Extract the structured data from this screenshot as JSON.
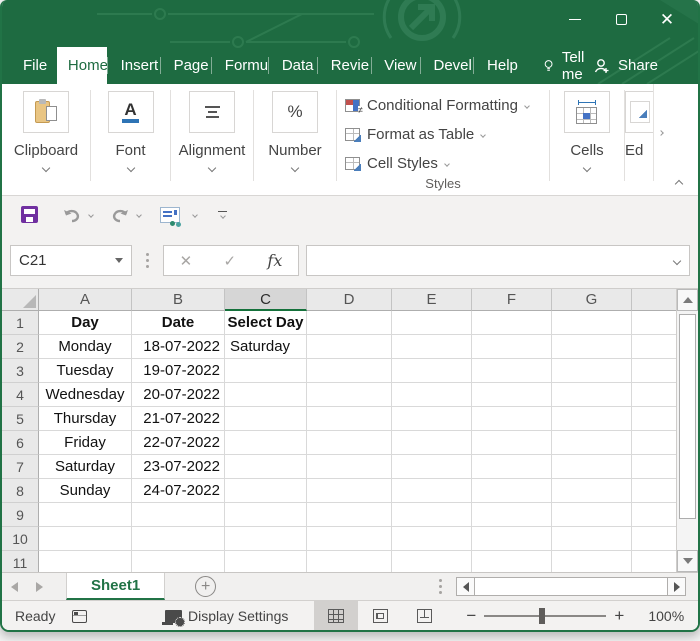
{
  "colors": {
    "title_green": "#1e6b41",
    "accent_green": "#217346",
    "selected_header_underline": "#15713b",
    "save_purple": "#7030a0",
    "font_underline_blue": "#2e74b5",
    "style_icon_blue": "#4472c4",
    "style_icon_red": "#c0504d"
  },
  "window_controls": {
    "minimize": "minimize",
    "maximize": "maximize",
    "close": "close"
  },
  "ribbon_tabs": [
    {
      "label": "File",
      "active": false
    },
    {
      "label": "Home",
      "active": true
    },
    {
      "label": "Insert",
      "active": false
    },
    {
      "label": "Page",
      "active": false
    },
    {
      "label": "Formu",
      "active": false
    },
    {
      "label": "Data",
      "active": false
    },
    {
      "label": "Revie",
      "active": false
    },
    {
      "label": "View",
      "active": false
    },
    {
      "label": "Devel",
      "active": false
    },
    {
      "label": "Help",
      "active": false
    }
  ],
  "tell_me_label": "Tell me",
  "share_label": "Share",
  "ribbon": {
    "groups": [
      {
        "label": "Clipboard"
      },
      {
        "label": "Font"
      },
      {
        "label": "Alignment"
      },
      {
        "label": "Number"
      }
    ],
    "styles_group": {
      "items": [
        {
          "label": "Conditional Formatting"
        },
        {
          "label": "Format as Table"
        },
        {
          "label": "Cell Styles"
        }
      ],
      "caption": "Styles"
    },
    "cells_label": "Cells",
    "editing_label": "Ed"
  },
  "formula_row": {
    "name_box": "C21",
    "cancel": "✕",
    "enter": "✓",
    "insert_function": "fx",
    "formula_value": ""
  },
  "grid": {
    "columns": [
      "A",
      "B",
      "C",
      "D",
      "E",
      "F",
      "G"
    ],
    "selected_column": "C",
    "rows": [
      {
        "n": "1",
        "cells": {
          "A": "Day",
          "B": "Date",
          "C": "Select Day"
        },
        "header": true
      },
      {
        "n": "2",
        "cells": {
          "A": "Monday",
          "B": "18-07-2022",
          "C": "Saturday"
        },
        "header": false
      },
      {
        "n": "3",
        "cells": {
          "A": "Tuesday",
          "B": "19-07-2022",
          "C": ""
        },
        "header": false
      },
      {
        "n": "4",
        "cells": {
          "A": "Wednesday",
          "B": "20-07-2022",
          "C": ""
        },
        "header": false
      },
      {
        "n": "5",
        "cells": {
          "A": "Thursday",
          "B": "21-07-2022",
          "C": ""
        },
        "header": false
      },
      {
        "n": "6",
        "cells": {
          "A": "Friday",
          "B": "22-07-2022",
          "C": ""
        },
        "header": false
      },
      {
        "n": "7",
        "cells": {
          "A": "Saturday",
          "B": "23-07-2022",
          "C": ""
        },
        "header": false
      },
      {
        "n": "8",
        "cells": {
          "A": "Sunday",
          "B": "24-07-2022",
          "C": ""
        },
        "header": false
      },
      {
        "n": "9",
        "cells": {
          "A": "",
          "B": "",
          "C": ""
        },
        "header": false
      },
      {
        "n": "10",
        "cells": {
          "A": "",
          "B": "",
          "C": ""
        },
        "header": false
      },
      {
        "n": "11",
        "cells": {
          "A": "",
          "B": "",
          "C": ""
        },
        "header": false
      }
    ]
  },
  "sheet_bar": {
    "active_sheet": "Sheet1",
    "add_sheet": "+"
  },
  "status_bar": {
    "ready": "Ready",
    "display_settings": "Display Settings",
    "zoom_level": "100%"
  }
}
